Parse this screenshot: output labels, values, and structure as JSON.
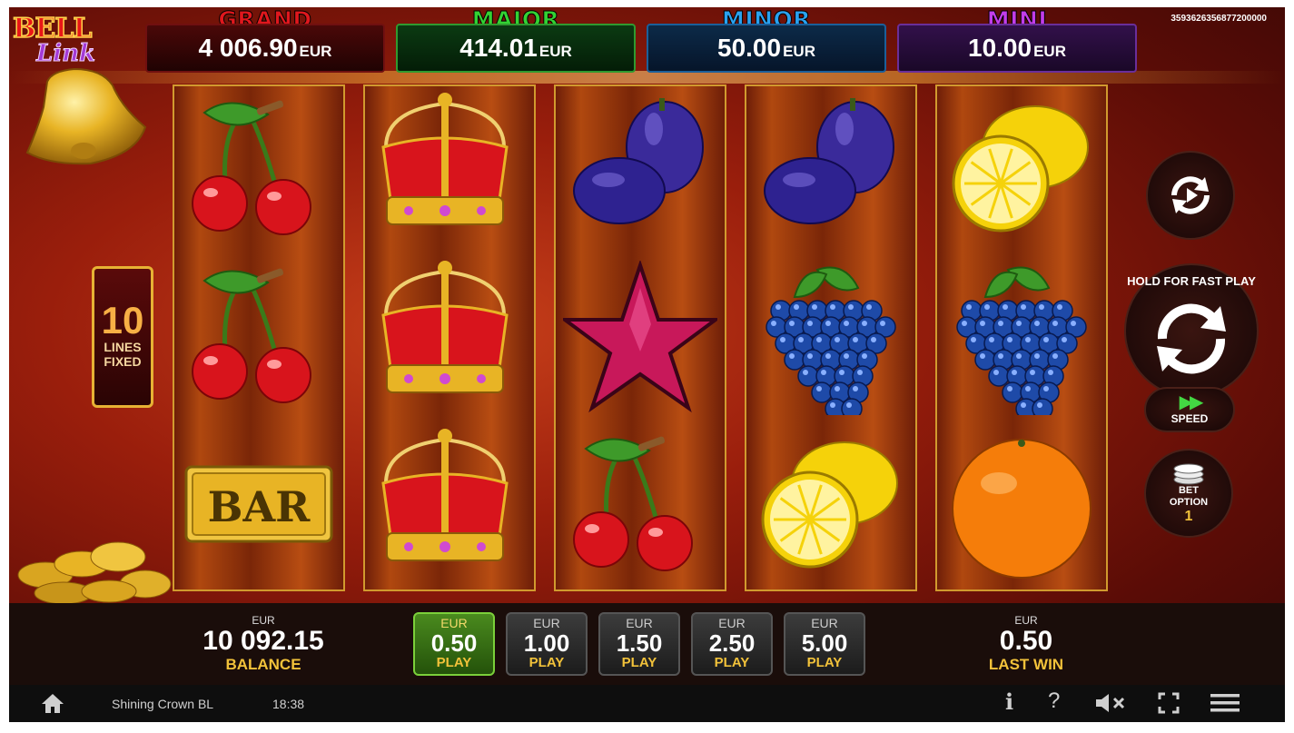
{
  "logo": {
    "line1": "BELL",
    "line2": "Link"
  },
  "game_id": "3593626356877200000",
  "jackpots": [
    {
      "name": "GRAND",
      "amount": "4 006.90",
      "currency": "EUR"
    },
    {
      "name": "MAJOR",
      "amount": "414.01",
      "currency": "EUR"
    },
    {
      "name": "MINOR",
      "amount": "50.00",
      "currency": "EUR"
    },
    {
      "name": "MINI",
      "amount": "10.00",
      "currency": "EUR"
    }
  ],
  "lines": {
    "count": "10",
    "label_1": "LINES",
    "label_2": "FIXED"
  },
  "reels": [
    [
      "cherries-icon",
      "cherries-icon",
      "bar-icon"
    ],
    [
      "crown-icon",
      "crown-icon",
      "crown-icon"
    ],
    [
      "plums-icon",
      "star-icon",
      "cherries-icon"
    ],
    [
      "plums-icon",
      "grapes-icon",
      "lemon-icon"
    ],
    [
      "lemon-icon",
      "grapes-icon",
      "orange-icon"
    ]
  ],
  "bar_symbol_text": "BAR",
  "controls": {
    "spin_label": "HOLD FOR FAST PLAY",
    "speed_label": "SPEED",
    "bet_option_label_1": "BET",
    "bet_option_label_2": "OPTION",
    "bet_option_value": "1"
  },
  "balance": {
    "currency": "EUR",
    "value": "10 092.15",
    "label": "BALANCE"
  },
  "bets": [
    {
      "currency": "EUR",
      "value": "0.50",
      "label": "PLAY",
      "active": true
    },
    {
      "currency": "EUR",
      "value": "1.00",
      "label": "PLAY",
      "active": false
    },
    {
      "currency": "EUR",
      "value": "1.50",
      "label": "PLAY",
      "active": false
    },
    {
      "currency": "EUR",
      "value": "2.50",
      "label": "PLAY",
      "active": false
    },
    {
      "currency": "EUR",
      "value": "5.00",
      "label": "PLAY",
      "active": false
    }
  ],
  "last_win": {
    "currency": "EUR",
    "value": "0.50",
    "label": "LAST WIN"
  },
  "footer": {
    "game_name": "Shining Crown BL",
    "time": "18:38",
    "info_glyph": "i",
    "help_glyph": "?"
  },
  "colors": {
    "gold": "#f2c23a",
    "active_bet": "#4a8a1e",
    "grand": "#e0171d",
    "major": "#33d233",
    "minor": "#2aa2f0",
    "mini": "#c23dea"
  }
}
